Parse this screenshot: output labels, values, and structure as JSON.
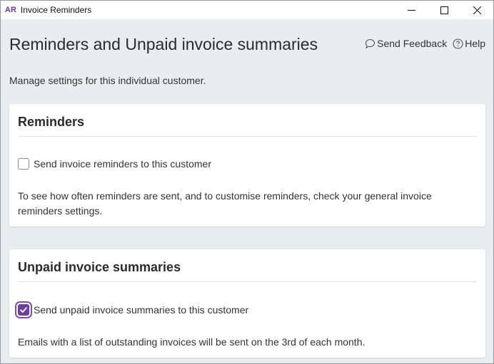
{
  "window": {
    "app_logo": "AR",
    "title": "Invoice Reminders"
  },
  "header": {
    "page_title": "Reminders and Unpaid invoice summaries",
    "send_feedback": "Send Feedback",
    "help": "Help",
    "subtitle": "Manage settings for this individual customer."
  },
  "reminders": {
    "title": "Reminders",
    "checkbox_label": "Send invoice reminders to this customer",
    "checkbox_checked": false,
    "description": "To see how often reminders are sent, and to customise reminders, check your general invoice reminders settings."
  },
  "summaries": {
    "title": "Unpaid invoice summaries",
    "checkbox_label": "Send unpaid invoice summaries to this customer",
    "checkbox_checked": true,
    "description": "Emails with a list of outstanding invoices will be sent on the 3rd of each month."
  },
  "colors": {
    "accent": "#6b3fa0",
    "background": "#eaedf0"
  }
}
